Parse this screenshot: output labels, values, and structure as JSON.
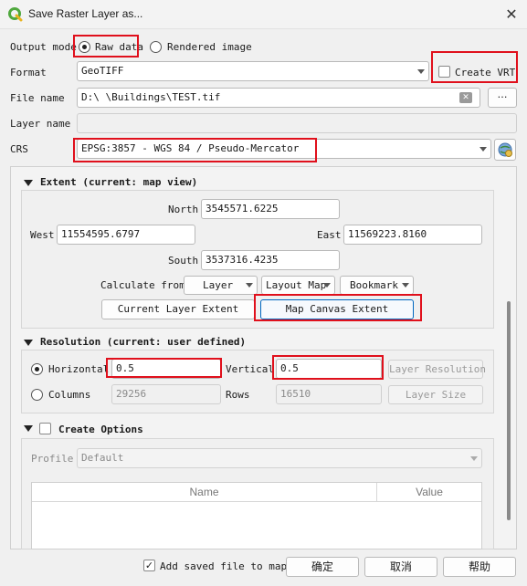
{
  "window": {
    "title": "Save Raster Layer as...",
    "close_glyph": "✕",
    "app_icon": "qgis-icon"
  },
  "output_mode": {
    "label": "Output mode",
    "options": [
      "Raw data",
      "Rendered image"
    ],
    "selected": "Raw data"
  },
  "format": {
    "label": "Format",
    "value": "GeoTIFF",
    "create_vrt_label": "Create VRT",
    "create_vrt_checked": false
  },
  "file_name": {
    "label": "File name",
    "value": "D:\\  \\Buildings\\TEST.tif",
    "clear_glyph": "✕",
    "browse_label": "…"
  },
  "layer_name": {
    "label": "Layer name",
    "value": ""
  },
  "crs": {
    "label": "CRS",
    "value": "EPSG:3857 - WGS 84 / Pseudo-Mercator"
  },
  "extent": {
    "title": "Extent (current: map view)",
    "north_label": "North",
    "north": "3545571.6225",
    "west_label": "West",
    "west": "11554595.6797",
    "east_label": "East",
    "east": "11569223.8160",
    "south_label": "South",
    "south": "3537316.4235",
    "calculate_from_label": "Calculate from",
    "layer_btn": "Layer",
    "layout_map_btn": "Layout Map",
    "bookmark_btn": "Bookmark",
    "current_layer_extent_btn": "Current Layer Extent",
    "map_canvas_extent_btn": "Map Canvas Extent"
  },
  "resolution": {
    "title": "Resolution (current: user defined)",
    "horizontal_label": "Horizontal",
    "horizontal": "0.5",
    "vertical_label": "Vertical",
    "vertical": "0.5",
    "layer_resolution_btn": "Layer Resolution",
    "columns_label": "Columns",
    "columns": "29256",
    "rows_label": "Rows",
    "rows": "16510",
    "layer_size_btn": "Layer Size",
    "selected": "Horizontal"
  },
  "create_options": {
    "title": "Create Options",
    "checked": false,
    "profile_label": "Profile",
    "profile_value": "Default",
    "columns": [
      "Name",
      "Value"
    ]
  },
  "footer": {
    "add_to_map_label": "Add saved file to map",
    "add_to_map_checked": true,
    "ok_label": "确定",
    "cancel_label": "取消",
    "help_label": "帮助"
  },
  "colors": {
    "highlight_red": "#e0101c",
    "accent_blue": "#0067c0"
  }
}
